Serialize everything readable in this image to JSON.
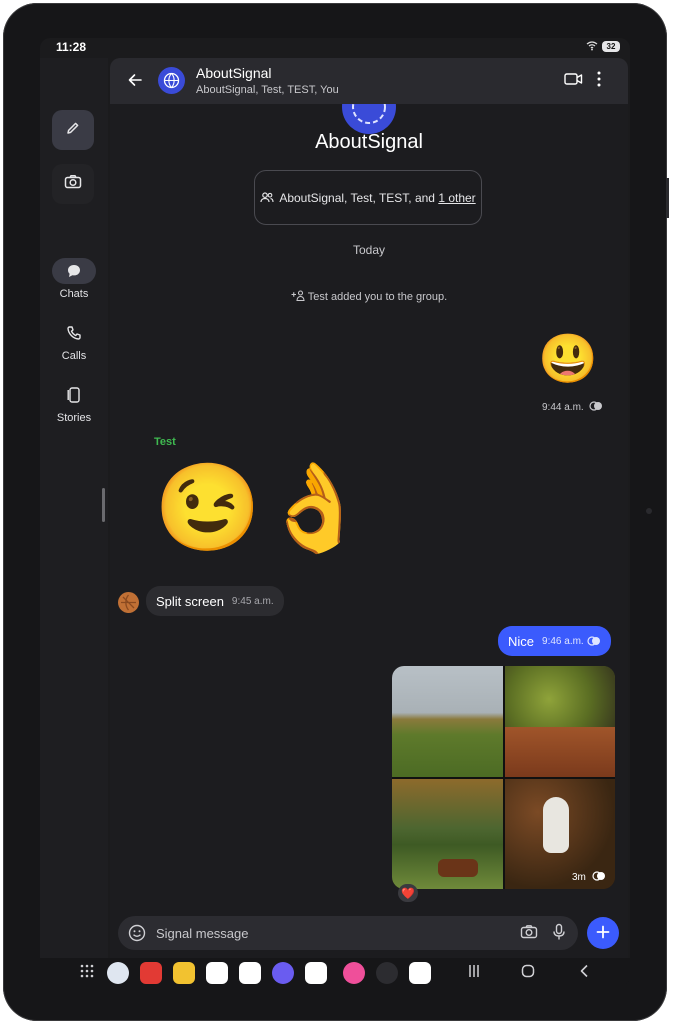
{
  "status_bar": {
    "time": "11:28",
    "battery": "32"
  },
  "nav": {
    "items": [
      {
        "label": "Chats",
        "icon": "chat-bubble-icon",
        "active": true
      },
      {
        "label": "Calls",
        "icon": "phone-icon"
      },
      {
        "label": "Stories",
        "icon": "stories-icon"
      }
    ]
  },
  "header": {
    "title": "AboutSignal",
    "subtitle": "AboutSignal, Test, TEST, You"
  },
  "group": {
    "name": "AboutSignal",
    "members_text": "AboutSignal, Test, TEST, and ",
    "members_link": "1 other"
  },
  "conversation": {
    "date_divider": "Today",
    "system_message": "Test added you to the group.",
    "messages": [
      {
        "direction": "outgoing",
        "type": "emoji",
        "content": "😃",
        "time": "9:44 a.m."
      },
      {
        "direction": "incoming",
        "sender": "Test",
        "type": "emoji",
        "content": "😉👌"
      },
      {
        "direction": "incoming",
        "type": "text",
        "content": "Split screen",
        "time": "9:45 a.m."
      },
      {
        "direction": "outgoing",
        "type": "text",
        "content": "Nice",
        "time": "9:46 a.m."
      },
      {
        "direction": "outgoing",
        "type": "album",
        "photo_count": 4,
        "time": "3m",
        "reaction": "❤️"
      }
    ]
  },
  "composer": {
    "placeholder": "Signal message"
  },
  "colors": {
    "accent": "#3b5bfd",
    "background": "#1c1c1f",
    "sender_test": "#3fb950"
  }
}
